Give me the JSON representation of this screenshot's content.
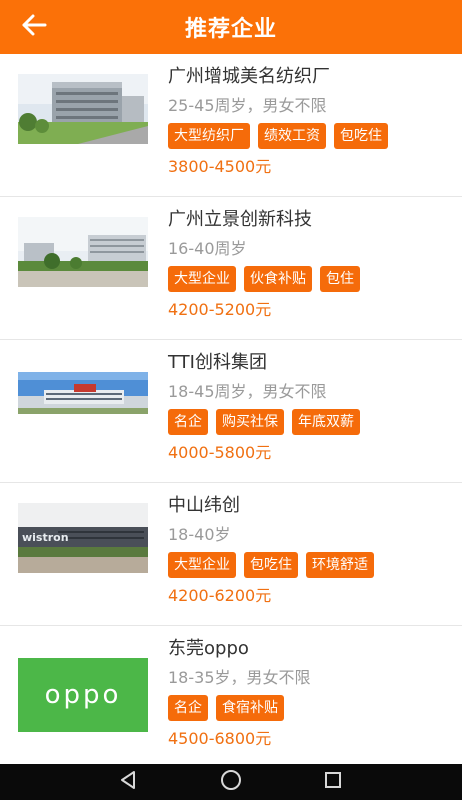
{
  "header": {
    "title": "推荐企业",
    "back_icon": "arrow-left-icon"
  },
  "companies": [
    {
      "name": "广州增城美名纺织厂",
      "conditions": "25-45周岁，男女不限",
      "tags": [
        "大型纺织厂",
        "绩效工资",
        "包吃住"
      ],
      "salary": "3800-4500元"
    },
    {
      "name": "广州立景创新科技",
      "conditions": "16-40周岁",
      "tags": [
        "大型企业",
        "伙食补贴",
        "包住"
      ],
      "salary": "4200-5200元"
    },
    {
      "name": "TTI创科集团",
      "conditions": "18-45周岁，男女不限",
      "tags": [
        "名企",
        "购买社保",
        "年底双薪"
      ],
      "salary": "4000-5800元"
    },
    {
      "name": "中山纬创",
      "conditions": "18-40岁",
      "tags": [
        "大型企业",
        "包吃住",
        "环境舒适"
      ],
      "salary": "4200-6200元",
      "logo_text": "wistron"
    },
    {
      "name": "东莞oppo",
      "conditions": "18-35岁，男女不限",
      "tags": [
        "名企",
        "食宿补贴"
      ],
      "salary": "4500-6800元",
      "logo_text": "oppo"
    }
  ],
  "system_nav": {
    "icons": [
      "back-triangle-icon",
      "home-circle-icon",
      "recents-square-icon"
    ]
  },
  "colors": {
    "accent": "#fb7108",
    "tag_bg": "#f56b0a",
    "salary": "#f07012",
    "oppo_green": "#4cb748"
  }
}
